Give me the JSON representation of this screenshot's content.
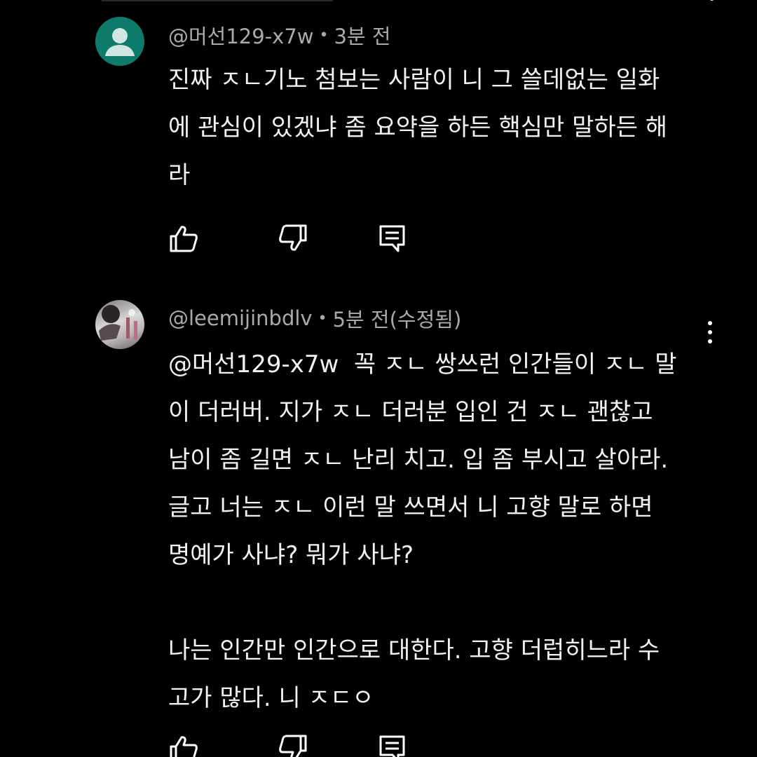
{
  "comments": [
    {
      "author": "@머선129-x7w",
      "separator": "•",
      "time": "3분 전",
      "avatar_icon": "default-person-avatar",
      "avatar_color": "#0e7a6a",
      "text": "진짜 ㅈㄴ기노 첨보는 사람이 니 그 쓸데없는 일화\n에 관심이 있겠냐 좀 요약을 하든 핵심만 말하든 해\n라",
      "actions": {
        "like_icon": "thumbs-up-icon",
        "dislike_icon": "thumbs-down-icon",
        "reply_icon": "reply-icon"
      }
    },
    {
      "author": "@leemijinbdlv",
      "separator": "•",
      "time": "5분 전(수정됨)",
      "avatar_icon": "user-photo-avatar",
      "text": "@머선129-x7w  꼭 ㅈㄴ 쌍쓰런 인간들이 ㅈㄴ 말\n이 더러버. 지가 ㅈㄴ 더러분 입인 건 ㅈㄴ 괜찮고\n남이 좀 길면 ㅈㄴ 난리 치고. 입 좀 부시고 살아라.\n글고 너는 ㅈㄴ 이런 말 쓰면서 니 고향 말로 하면\n명예가 사냐? 뭐가 사냐?\n\n나는 인간만 인간으로 대한다. 고향 더럽히느라 수\n고가 많다. 니 ㅈㄷㅇ",
      "actions": {
        "like_icon": "thumbs-up-icon",
        "dislike_icon": "thumbs-down-icon",
        "reply_icon": "reply-icon"
      },
      "menu_icon": "more-vertical-icon"
    }
  ],
  "colors": {
    "background": "#000000",
    "meta_text": "#aaaaaa",
    "body_text": "#f1f1f1"
  }
}
